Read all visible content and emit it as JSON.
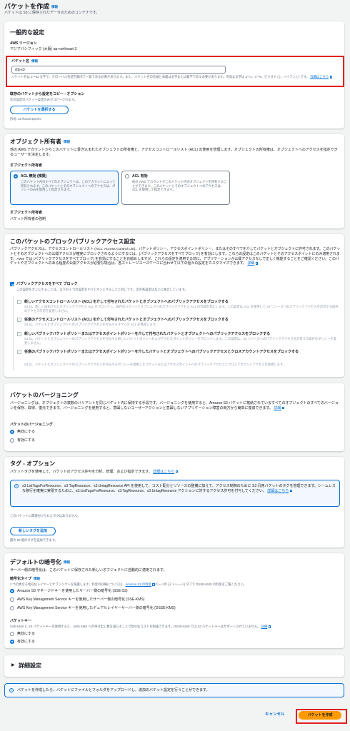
{
  "page": {
    "title": "バケットを作成",
    "info": "情報",
    "subtitle": "バケットは S3 に保存されたデータのためのコンテナです。"
  },
  "general": {
    "title": "一般的な設定",
    "region_label": "AWS リージョン",
    "region_value": "アジアパシフィック (大阪) ap-northeast-3",
    "bucket_name_label": "バケット名",
    "bucket_name_info": "情報",
    "bucket_name_value": "d1j-s3",
    "help_1": "バケット名は 3～63 文字で、グローバル名前空間内で一意である必要があります。また、バケット名の先頭と末尾は文字または数字である必要があります。有効な文字は a～z、0～9、ピリオド (.)、ハイフン (-) です。",
    "help_link": "詳細はこちら",
    "copy_label": "既存のバケットから設定をコピー - オプション",
    "copy_desc": "次の設定のバケット設定のみがコピーされます。",
    "choose_bucket": "バケットを選択する",
    "format": "形式: s3://bucket/prefix"
  },
  "ownership": {
    "title": "オブジェクト所有者",
    "info": "情報",
    "desc": "他の AWS アカウントからこのバケットに書き込まれたオブジェクトの所有権と、アクセスコントロールリスト (ACL) の使用を管理します。オブジェクトの所有権は、オブジェクトへのアクセスを指定できるユーザーを決定します。",
    "field_label": "オブジェクト所有者",
    "opt1_title": "ACL 無効 (推奨)",
    "opt1_desc": "このバケット内のすべてのオブジェクトは、このアカウントによって所有されます。このバケットとそのオブジェクトへのアクセスは、ポリシーのみを使用して指定されます。",
    "opt2_title": "ACL 有効",
    "opt2_desc": "他の AWS アカウントがこのバケット内のオブジェクトを所有することができます。このバケットとそのオブジェクトへのアクセスは、ACL を使用して指定できます。",
    "owner_label": "オブジェクト所有者",
    "owner_value": "バケット所有者の強制"
  },
  "bpa": {
    "title": "このバケットのブロックパブリックアクセス設定",
    "desc": "パブリックアクセスは、アクセスコントロールリスト (ACL: Access Control List)、バケットポリシー、アクセスポイントポリシー、またはそのすべてを介してバケットとオブジェクトに許可されます。このバケットとそのオブジェクトへの公開アクセスが確実にブロックされるようにするには、[パブリックアクセスをすべてブロック] を有効にします。これらの設定はこのバケットとそのアクセスポイントにのみ適用されます。AWS では [パブリックアクセスをすべてブロック] を有効にすることをお勧めしますが、これらの設定を適用する前に、アプリケーションが公開アクセスなしで正しく機能することをご確認ください。このバケットやオブジェクトへのある程度の公開アクセスが必要な場合は、各ストレージユースケースに合わせて以下の個々の設定をカスタマイズできます。",
    "desc_link": "詳細",
    "all_label": "パブリックアクセスをすべて ブロック",
    "all_desc": "この設定をオンにすることは、以下の 4 つの設定をすべてオンにすることと同じです。次の各設定は互いに独立しています。",
    "items": [
      {
        "title": "新しいアクセスコントロールリスト (ACL) を介して付与されたバケットとオブジェクトへのパブリックアクセスをブロックする",
        "desc": "S3 は、新しく追加されたパブリックアクセス ACL をブロックし、既存のバケットとオブジェクトのパブリックアクセス ACL の作成を禁止します。この設定は ACL を使用して S3 リソースへのパブリックアクセスを許可する既存のアクセス許可を変更しません。"
      },
      {
        "title": "任意のアクセスコントロールリスト (ACL) を介して付与されたバケットとオブジェクトへのパブリックアクセスをブロックする",
        "desc": "S3 は、バケットとオブジェクトへのパブリックアクセスを付与するすべての ACL を無視します。"
      },
      {
        "title": "新しいパブリックバケットポリシーまたはアクセスポイントポリシーを介して付与されたバケットとオブジェクトへのパブリックアクセスをブロックする",
        "desc": "S3 は、バケットとオブジェクトへのパブリックアクセスを付与する新しいバケットポリシーおよびアクセスポイントポリシーをブロックします。この設定は、S3 リソースへのパブリックアクセスを許可する既存のポリシーを変更しません。"
      },
      {
        "title": "任意のパブリックバケットポリシーまたはアクセスポイントポリシーを介したバケットとオブジェクトへのパブリックアクセスとクロスアカウントアクセスをブロックする",
        "desc": "S3 は、バケットとオブジェクトへのパブリックアクセスを付与するポリシーを使用したバケットまたはアクセスポイントへのパブリックアクセスとクロスアカウントアクセスを無視します。"
      }
    ]
  },
  "versioning": {
    "title": "バケットのバージョニング",
    "desc": "バージョニングは、オブジェクトの複数のバリアントを同じバケット内に保持する手段です。バージョニングを使用すると、Amazon S3 バケットに格納されているすべてのオブジェクトのすべてのバージョンを保存、取得、復元できます。バージョニングを使用すると、意図しないユーザーアクションと意図しないアプリケーション障害の両方から簡単に復旧できます。",
    "desc_link": "詳細",
    "field_label": "バケットのバージョニング",
    "opt_disable": "無効にする",
    "opt_enable": "有効にする"
  },
  "tags": {
    "title": "タグ - オプション",
    "desc": "バケットタグを使用して、バケットのアクセス許可を分析、管理、および指定できます。",
    "desc_link": "詳細はこちら",
    "note": "s3:ListTagsForResource、s3:TagResource、s3:UntagResource API を使用して、コスト配分とリソースの整備に加えて、アクセス制御のために S3 汎用バケットのタグを管理できます。シームレスな移行を確実に実現するために、s3:ListTagsForResource、s3:TagResource、s3:UntagResource アクションに対するアクセス許可を付与してください。",
    "note_link": "詳細はこちら",
    "empty": "このバケットに関連付けられたタグはありません。",
    "add_button": "新しいタグを追加",
    "limit": "最大 50 個のタグを追加できます。"
  },
  "encryption": {
    "title": "デフォルトの暗号化",
    "info": "情報",
    "desc": "サーバー側の暗号化は、このバケットに保存された新しいオブジェクトに自動的に適用されます。",
    "type_label": "暗号化タイプ",
    "type_info": "情報",
    "type_desc_1": "2 つの異なる暗号化レイヤーでオブジェクトを保護します。料金の詳細については、",
    "type_desc_link": "Amazon S3 の料金",
    "type_desc_2": "ページの [ストレージ] タブで DSSE-KMS の料金をご覧ください。",
    "opt1": "Amazon S3 マネージドキーを使用したサーバー側の暗号化 (SSE-S3)",
    "opt2": "AWS Key Management Service キーを使用したサーバー側の暗号化 (SSE-KMS)",
    "opt3": "AWS Key Management Service キーを使用したデュアルレイヤーサーバー側の暗号化 (DSSE-KMS)",
    "key_label": "バケットキー",
    "key_desc": "SSE-KMS に S3 バケットキーを使用すると、AWS KMS への呼び出し数を減らすことで暗号化コストを削減できます。DSSE-KMS では S3 バケットキーはサポートされていません。",
    "key_link": "詳細",
    "opt_disable": "無効にする",
    "opt_enable": "有効にする"
  },
  "advanced": {
    "title": "詳細設定"
  },
  "footer": {
    "note": "バケットを作成したら、バケットにファイルとフォルダをアップロードし、追加のバケット設定を行うことができます。",
    "cancel": "キャンセル",
    "create": "バケットを作成"
  }
}
